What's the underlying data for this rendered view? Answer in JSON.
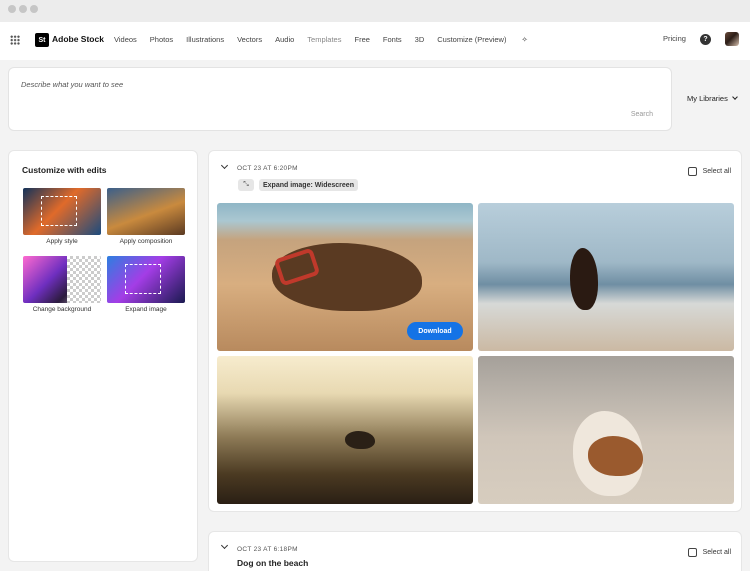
{
  "nav": {
    "logo_mark": "St",
    "brand": "Adobe Stock",
    "links": [
      "Videos",
      "Photos",
      "Illustrations",
      "Vectors",
      "Audio",
      "Templates",
      "Free",
      "Fonts",
      "3D",
      "Customize (Preview)"
    ],
    "pricing": "Pricing",
    "help_glyph": "?"
  },
  "search": {
    "placeholder": "Describe what you want to see",
    "button": "Search"
  },
  "libraries": {
    "label": "My Libraries"
  },
  "customize": {
    "title": "Customize with edits",
    "tiles": [
      "Apply style",
      "Apply composition",
      "Change background",
      "Expand image"
    ]
  },
  "results": [
    {
      "timestamp": "OCT 23 AT 6:20PM",
      "edit_chip": "Expand image: Widescreen",
      "select_all": "Select all",
      "download": "Download"
    },
    {
      "timestamp": "OCT 23 AT 6:18PM",
      "prompt": "Dog on the beach",
      "select_all": "Select all"
    }
  ],
  "colors": {
    "accent": "#1473e6",
    "background": "#f3f3f3"
  }
}
